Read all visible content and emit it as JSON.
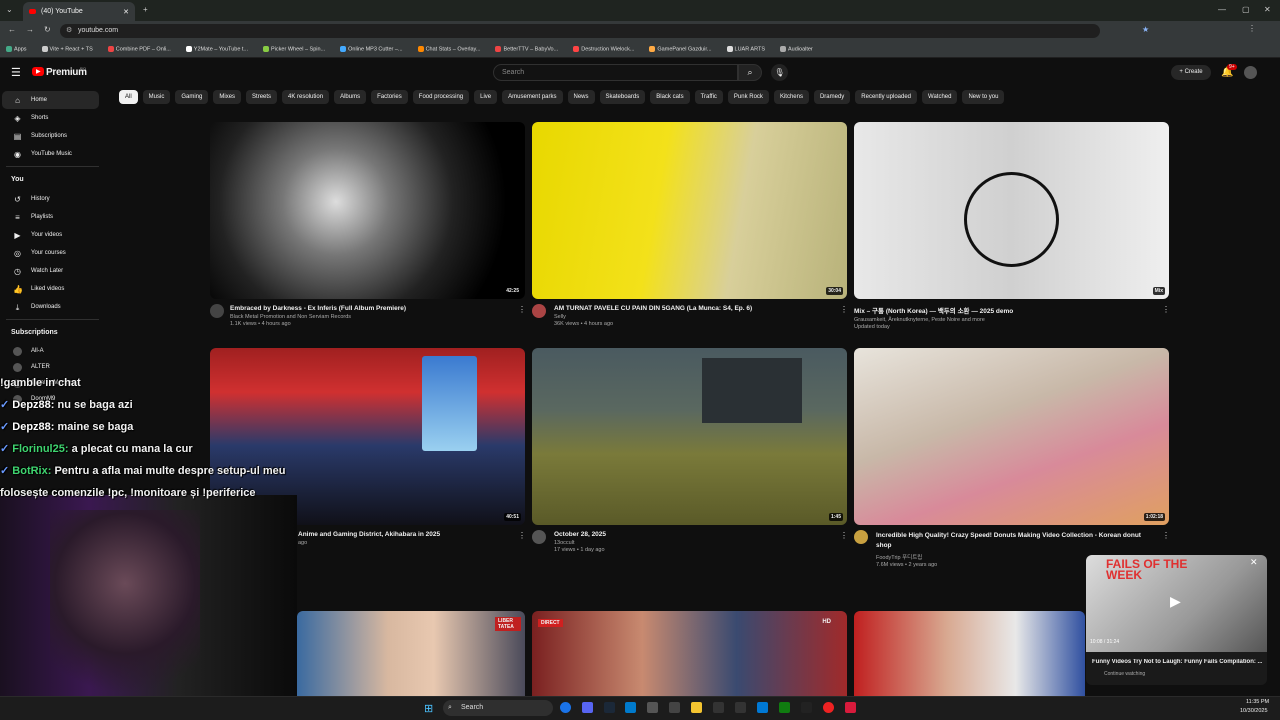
{
  "browser": {
    "tab_title": "(40) YouTube",
    "new_tab": "+",
    "url": "youtube.com",
    "bookmarks": [
      "Apps",
      "Vite + React + TS",
      "Combine PDF – Onli...",
      "Y2Mate – YouTube t...",
      "Picker Wheel – Spin...",
      "Online MP3 Cutter –...",
      "Chat Stats – Overlay...",
      "BetterTTV – BabyVo...",
      "Destruction Wielock...",
      "GamePanel Gazduir...",
      "LUAR ARTS",
      "Audioalter"
    ]
  },
  "header": {
    "logo": "Premium",
    "logo_sup": "RO",
    "search_placeholder": "Search",
    "create_label": "Create",
    "notif_count": "9+"
  },
  "chips": [
    "All",
    "Music",
    "Gaming",
    "Mixes",
    "Streets",
    "4K resolution",
    "Albums",
    "Factories",
    "Food processing",
    "Live",
    "Amusement parks",
    "News",
    "Skateboards",
    "Black cats",
    "Traffic",
    "Punk Rock",
    "Kitchens",
    "Dramedy",
    "Recently uploaded",
    "Watched",
    "New to you"
  ],
  "sidebar": {
    "main": [
      {
        "label": "Home",
        "icon": "home-icon",
        "glyph": "⌂"
      },
      {
        "label": "Shorts",
        "icon": "shorts-icon",
        "glyph": "◈"
      },
      {
        "label": "Subscriptions",
        "icon": "subscriptions-icon",
        "glyph": "▤"
      },
      {
        "label": "YouTube Music",
        "icon": "music-icon",
        "glyph": "◉"
      }
    ],
    "you_heading": "You",
    "you": [
      {
        "label": "History",
        "icon": "history-icon",
        "glyph": "↺"
      },
      {
        "label": "Playlists",
        "icon": "playlists-icon",
        "glyph": "≡"
      },
      {
        "label": "Your videos",
        "icon": "your-videos-icon",
        "glyph": "▶"
      },
      {
        "label": "Your courses",
        "icon": "courses-icon",
        "glyph": "◎"
      },
      {
        "label": "Watch Later",
        "icon": "watch-later-icon",
        "glyph": "◷"
      },
      {
        "label": "Liked videos",
        "icon": "liked-icon",
        "glyph": "👍"
      },
      {
        "label": "Downloads",
        "icon": "downloads-icon",
        "glyph": "⤓"
      }
    ],
    "subs_heading": "Subscriptions",
    "subs": [
      "All-A",
      "ALTER",
      "CreativeMonkey",
      "DoomM9"
    ]
  },
  "videos": [
    {
      "title": "Embraced by Darkness - Ex Inferis (Full Album Premiere)",
      "channel": "Black Metal Promotion and Non Serviam Records",
      "stats": "1.1K views • 4 hours ago",
      "duration": "42:25"
    },
    {
      "title": "AM TURNAT PAVELE CU PAIN DIN 5GANG (La Munca: S4, Ep. 6)",
      "channel": "Selly",
      "stats": "36K views • 4 hours ago",
      "duration": "30:04"
    },
    {
      "title": "Mix – 구퉁 (North Korea) — 백두의 소환 — 2025 demo",
      "channel": "Grausamkeit, Äreknutknyterne, Peste Noire and more",
      "stats": "Updated today",
      "duration": "Mix"
    },
    {
      "title": "Anime and Gaming District, Akihabara in 2025",
      "channel": "",
      "stats": "ago",
      "duration": "40:51"
    },
    {
      "title": "October 28, 2025",
      "channel": "13occult",
      "stats": "17 views • 1 day ago",
      "duration": "1:45"
    },
    {
      "title": "Incredible High Quality! Crazy Speed! Donuts Making Video Collection - Korean donut shop",
      "channel": "FoodyTrip 푸디트립",
      "stats": "7.6M views • 2 years ago",
      "duration": "1:02:18"
    }
  ],
  "chat": [
    {
      "user": "",
      "text": "!gamble in chat",
      "color": "#ffffff"
    },
    {
      "user": "Depz88:",
      "text": " nu se baga azi",
      "color": "#ffffff"
    },
    {
      "user": "Depz88:",
      "text": " maine se baga",
      "color": "#ffffff"
    },
    {
      "user": "Florinul25:",
      "text": " a plecat cu mana la cur",
      "color": "#3fd46f"
    },
    {
      "user": "BotRix:",
      "text": " Pentru a afla mai multe despre setup-ul meu",
      "color": "#3fd46f"
    },
    {
      "user": "",
      "text": "folosește comenzile !pc, !monitoare și !periferice",
      "color": "#ffffff"
    }
  ],
  "miniplayer": {
    "banner": "FAILS OF THE WEEK",
    "time": "10:08 / 31:24",
    "title": "Funny Videos Try Not to Laugh: Funny Fails Compilation: ...",
    "sub": "Continue watching"
  },
  "third_row_badges": {
    "liber": "LIBER TATEA",
    "direct": "DIRECT",
    "hd": "HD"
  },
  "taskbar": {
    "search": "Search",
    "time": "11:35 PM",
    "date": "10/30/2025"
  }
}
